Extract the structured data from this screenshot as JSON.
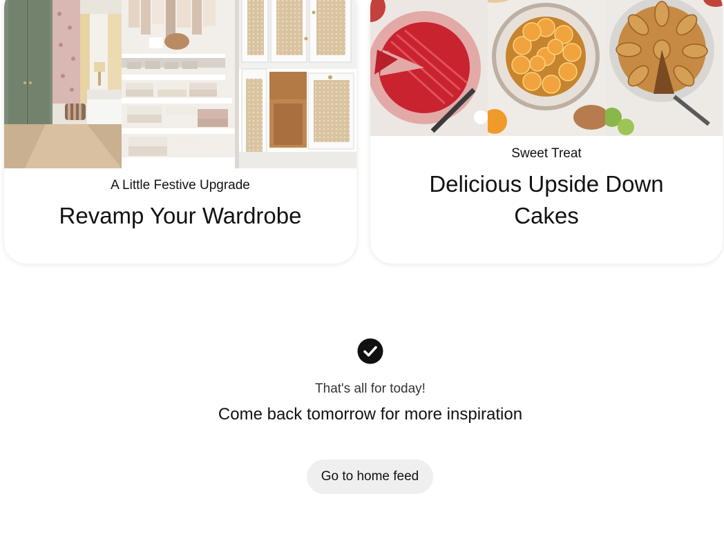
{
  "cards": [
    {
      "subtitle": "A Little Festive Upgrade",
      "title": "Revamp Your Wardrobe",
      "images": [
        "bedroom-with-green-wardrobe",
        "open-closet-with-folded-linens",
        "white-cane-cabinets-with-drawers"
      ]
    },
    {
      "subtitle": "Sweet Treat",
      "title": "Delicious Upside Down Cakes",
      "images": [
        "rhubarb-cake-sliced",
        "orange-upside-down-cake",
        "pear-upside-down-cake"
      ]
    }
  ],
  "end_message": {
    "icon": "checkmark-circle-icon",
    "line1": "That's all for today!",
    "line2": "Come back tomorrow for more inspiration"
  },
  "home_button": {
    "label": "Go to home feed"
  },
  "colors": {
    "background": "#ffffff",
    "text": "#111111",
    "button_bg": "#efefef",
    "check_bg": "#111111"
  }
}
